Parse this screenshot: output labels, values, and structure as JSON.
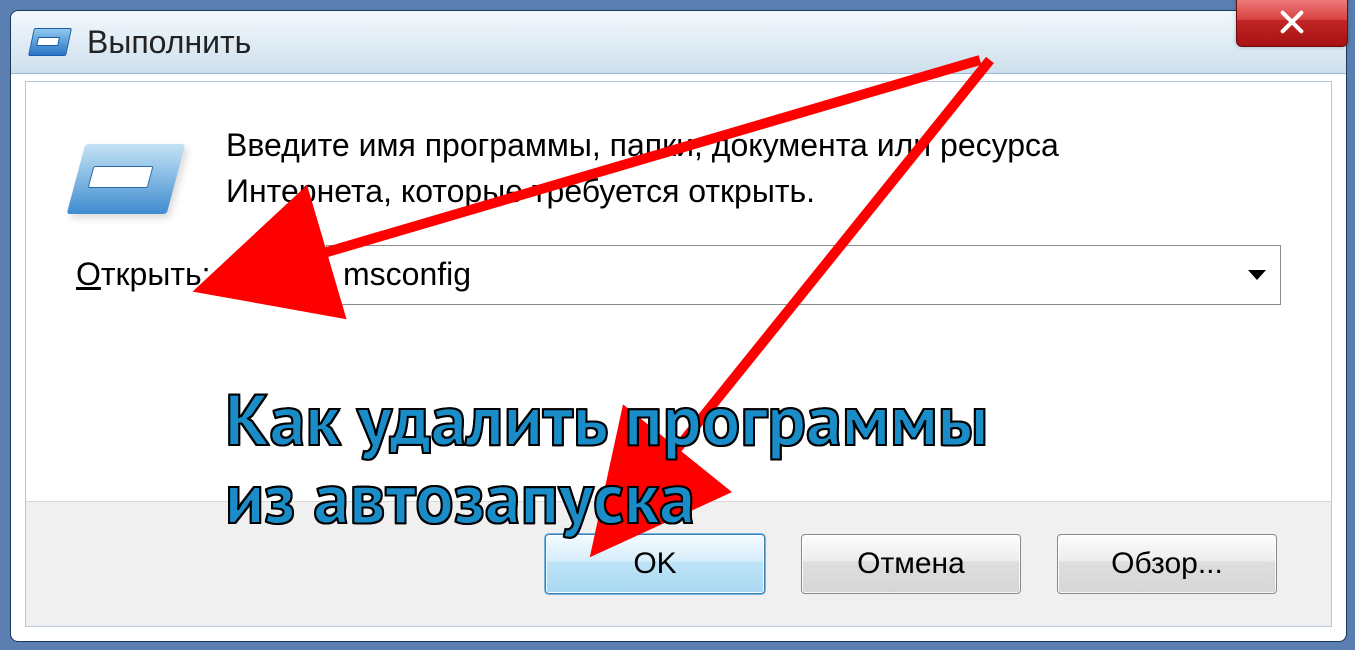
{
  "window": {
    "title": "Выполнить"
  },
  "description": "Введите имя программы, папки, документа или ресурса Интернета, которые требуется открыть.",
  "open_label_pre": "О",
  "open_label_post": "ткрыть:",
  "input_value": "msconfig",
  "buttons": {
    "ok": "OK",
    "cancel": "Отмена",
    "browse": "Обзор..."
  },
  "annotation": {
    "caption_line1": "Как удалить программы",
    "caption_line2": "из автозапуска"
  }
}
